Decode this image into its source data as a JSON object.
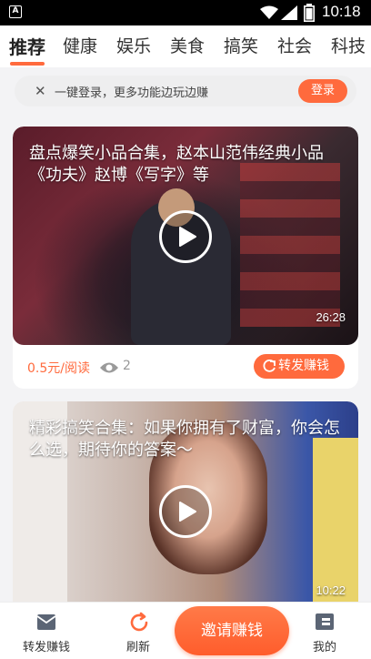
{
  "status_bar": {
    "app_icon_letter": "A",
    "time": "10:18"
  },
  "tabs": [
    {
      "label": "推荐",
      "active": true
    },
    {
      "label": "健康"
    },
    {
      "label": "娱乐"
    },
    {
      "label": "美食"
    },
    {
      "label": "搞笑"
    },
    {
      "label": "社会"
    },
    {
      "label": "科技"
    }
  ],
  "login_banner": {
    "close_icon": "close-icon",
    "text": "一键登录，更多功能边玩边赚",
    "button_label": "登录"
  },
  "accent_color": "#ff6a3d",
  "feed": [
    {
      "title": "盘点爆笑小品合集，赵本山范伟经典小品《功夫》赵博《写字》等",
      "duration": "26:28",
      "price": "0.5元/阅读",
      "views": "2",
      "share_label": "转发赚钱"
    },
    {
      "title": "精彩搞笑合集：如果你拥有了财富，你会怎么选，期待你的答案～",
      "duration": "10:22"
    }
  ],
  "bottom_nav": {
    "share_label": "转发赚钱",
    "refresh_label": "刷新",
    "invite_label": "邀请赚钱",
    "mine_label": "我的"
  }
}
